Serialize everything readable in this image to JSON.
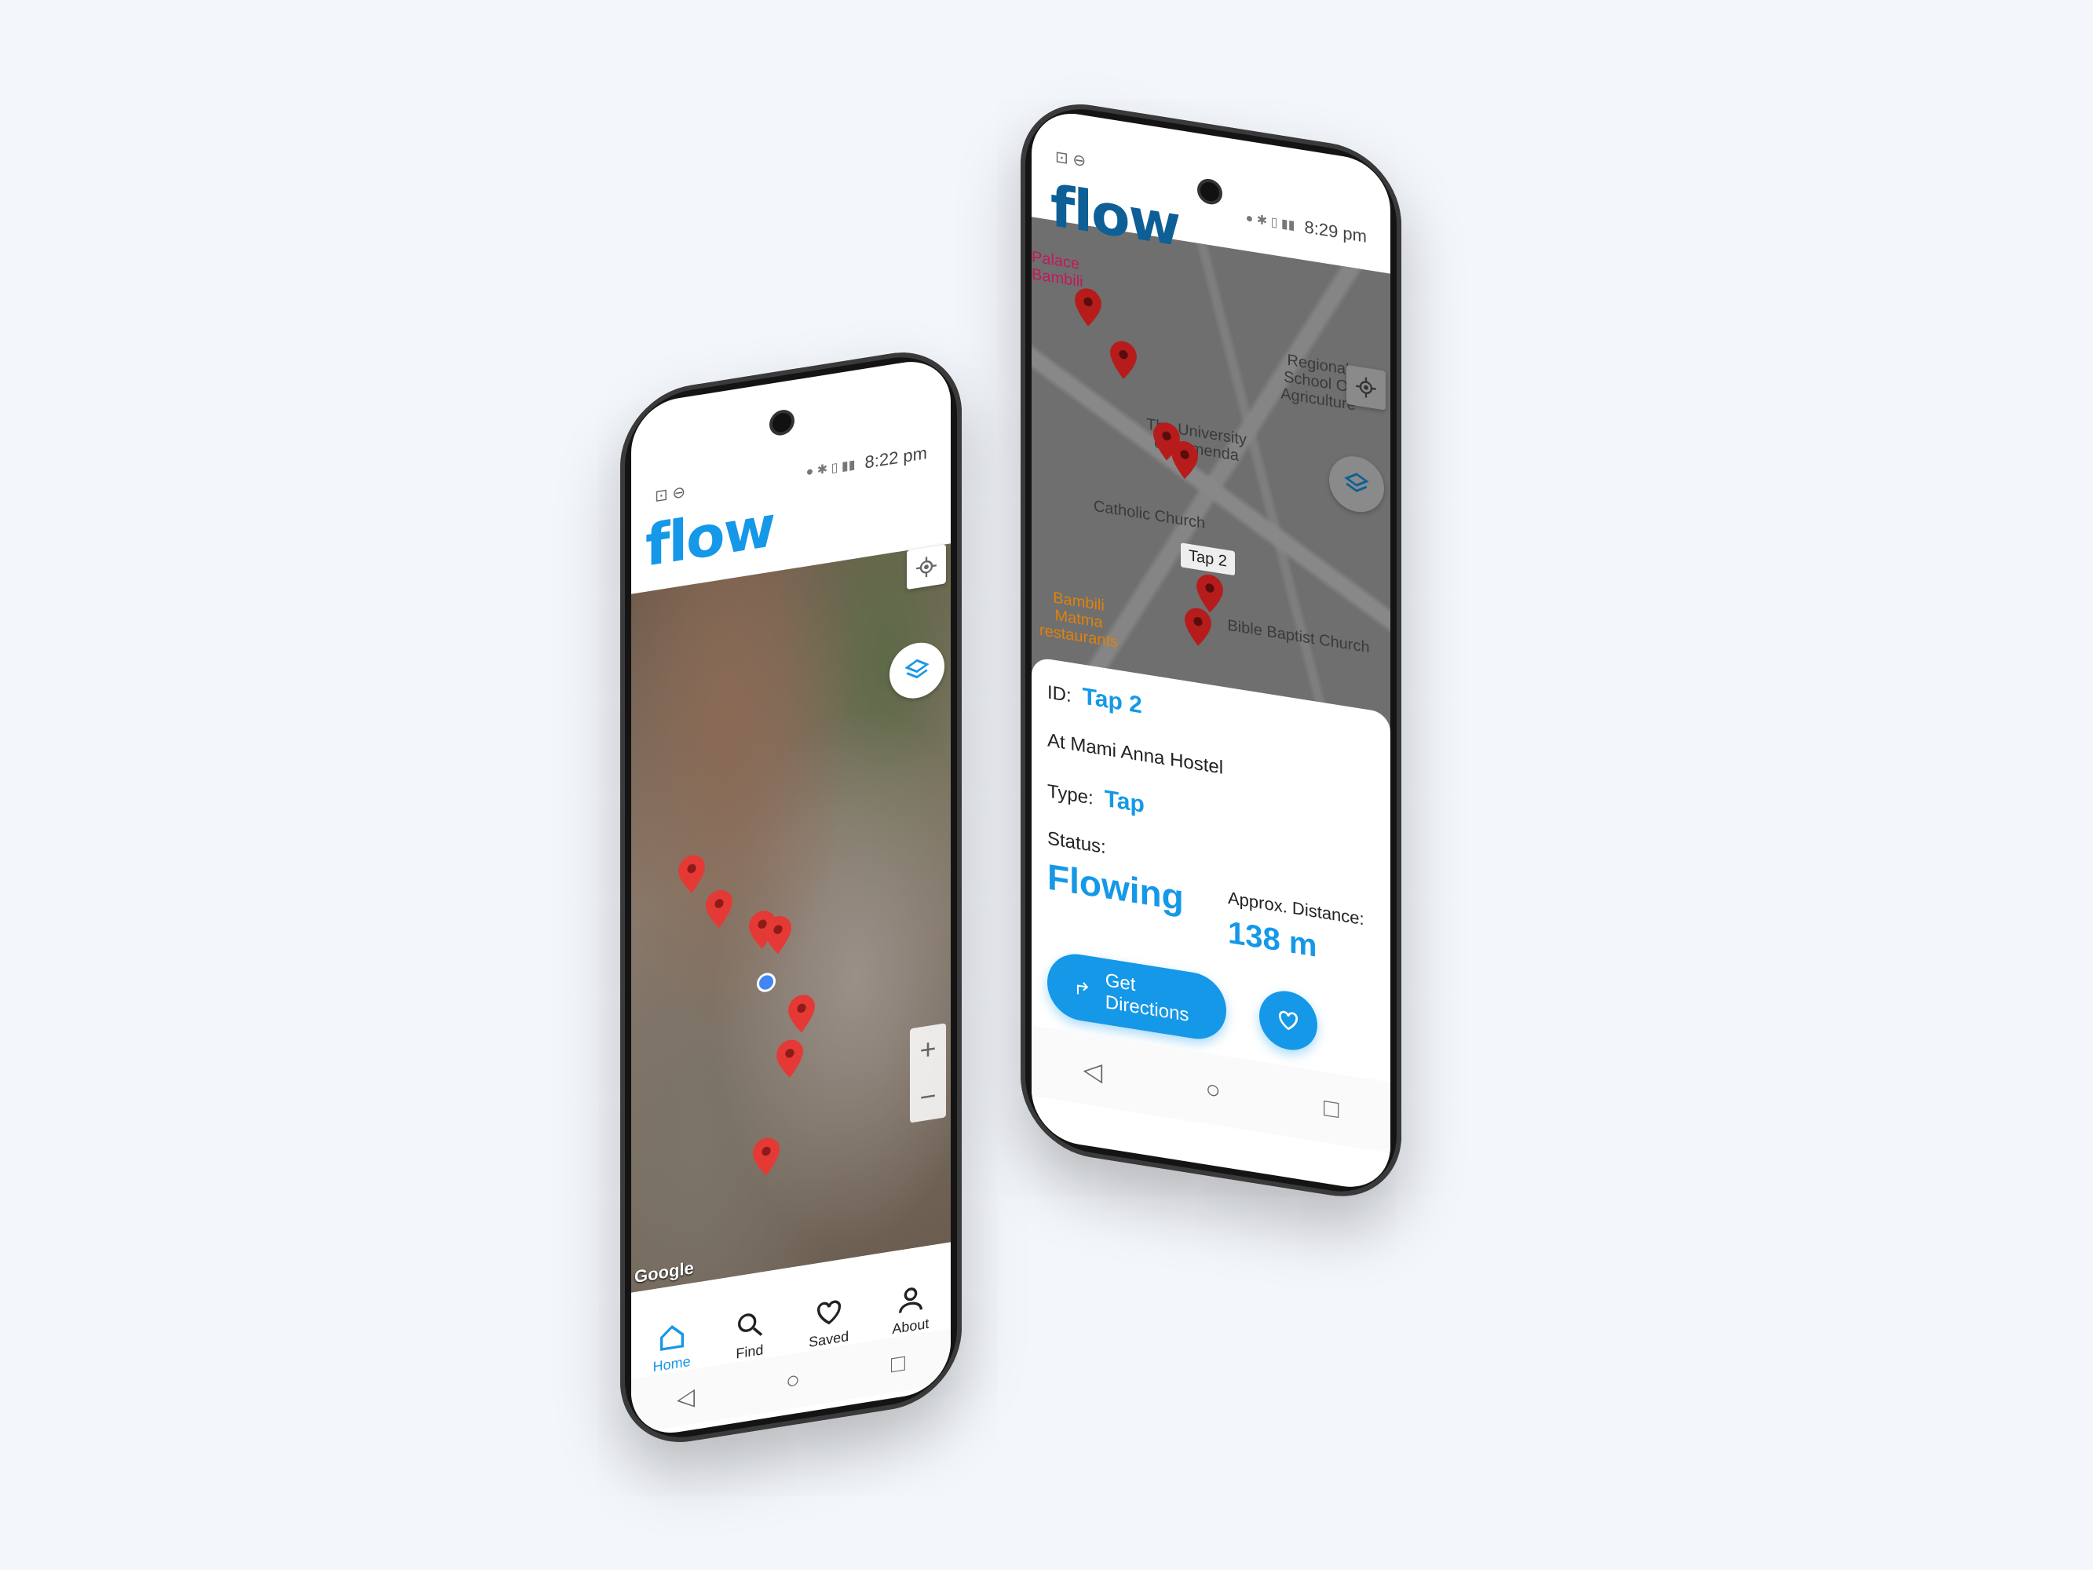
{
  "app": {
    "brand": "flow",
    "brand_color": "#1598e8"
  },
  "phone_left": {
    "status": {
      "left_icons": "⊡ ⊖",
      "time": "8:22 pm"
    },
    "map": {
      "type": "satellite",
      "attribution": "Google",
      "zoom_in": "+",
      "zoom_out": "−"
    },
    "tabs": [
      {
        "label": "Home",
        "icon": "home-icon",
        "active": true
      },
      {
        "label": "Find",
        "icon": "search-icon",
        "active": false
      },
      {
        "label": "Saved",
        "icon": "heart-icon",
        "active": false
      },
      {
        "label": "About",
        "icon": "user-icon",
        "active": false
      }
    ]
  },
  "phone_right": {
    "status": {
      "left_icons": "⊡ ⊖",
      "time": "8:29 pm"
    },
    "map": {
      "places": [
        "Palace Bambili",
        "Regional School Of Agriculture",
        "The University of Bamenda",
        "Catholic Church",
        "Bambili Matma restaurants",
        "Bible Baptist Church"
      ],
      "callout": "Tap 2"
    },
    "detail": {
      "id_label": "ID:",
      "id_value": "Tap 2",
      "location": "At Mami Anna Hostel",
      "type_label": "Type:",
      "type_value": "Tap",
      "status_label": "Status:",
      "status_value": "Flowing",
      "distance_label": "Approx. Distance:",
      "distance_value": "138 m",
      "directions_button": "Get Directions"
    }
  }
}
